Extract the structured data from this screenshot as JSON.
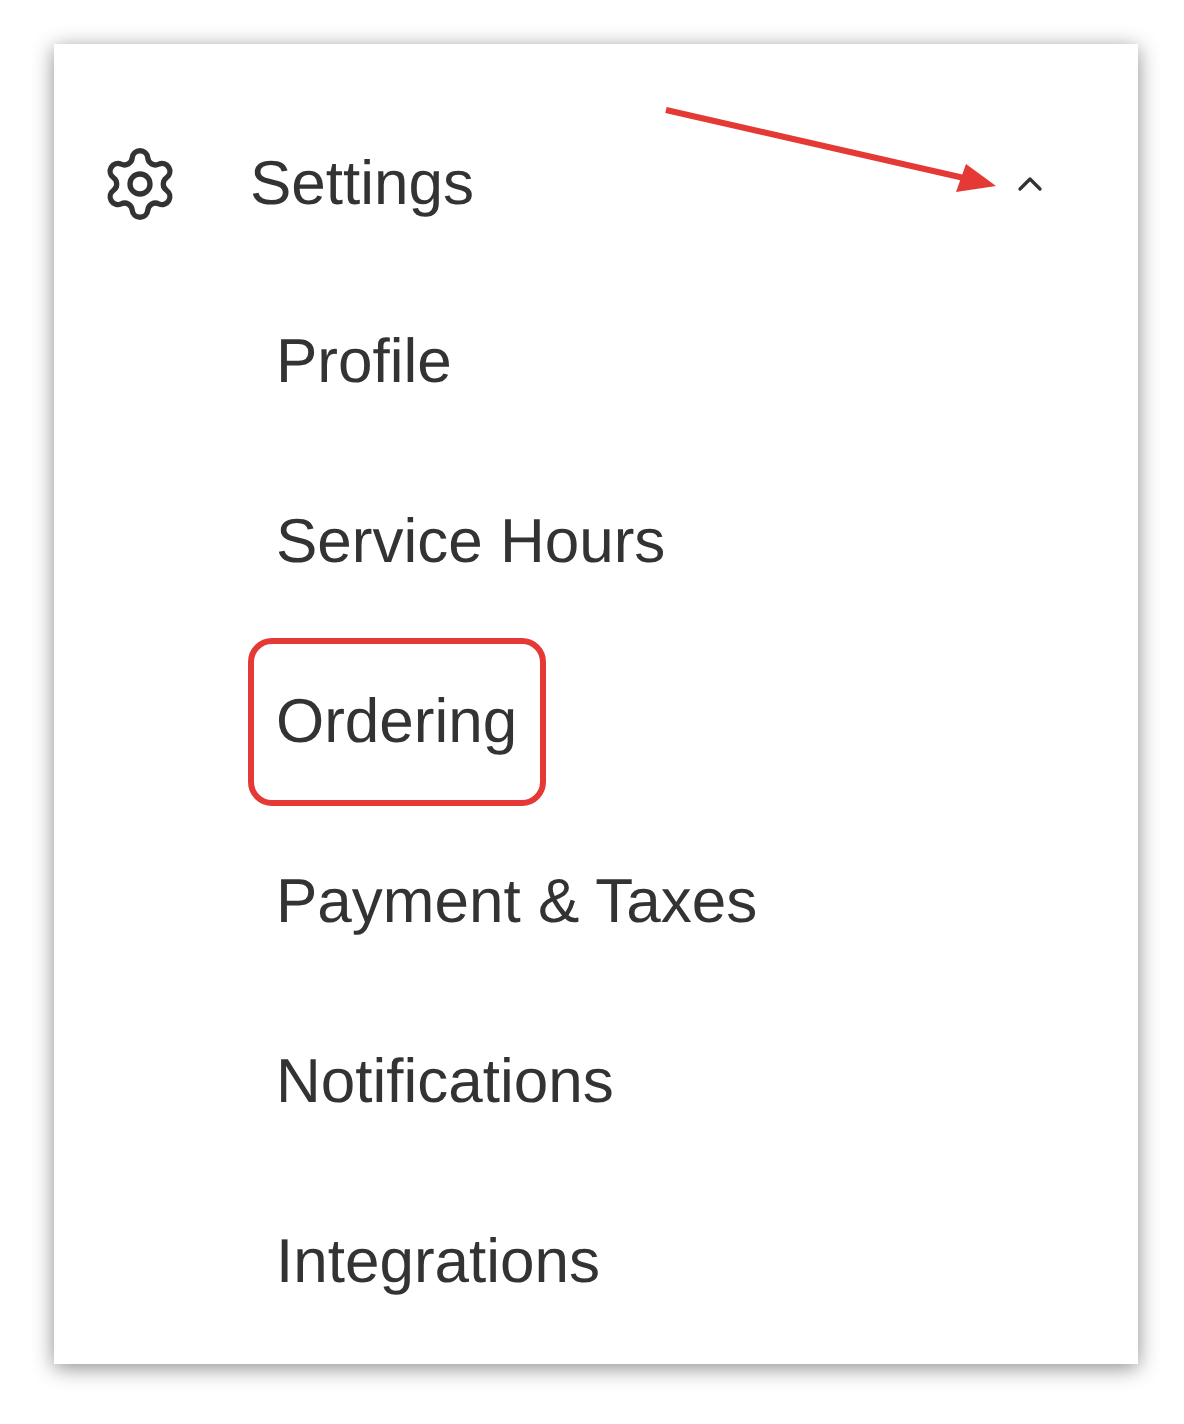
{
  "menu": {
    "title": "Settings",
    "expanded": true,
    "items": [
      {
        "label": "Profile",
        "highlighted": false
      },
      {
        "label": "Service Hours",
        "highlighted": false
      },
      {
        "label": "Ordering",
        "highlighted": true
      },
      {
        "label": "Payment & Taxes",
        "highlighted": false
      },
      {
        "label": "Notifications",
        "highlighted": false
      },
      {
        "label": "Integrations",
        "highlighted": false
      }
    ]
  }
}
